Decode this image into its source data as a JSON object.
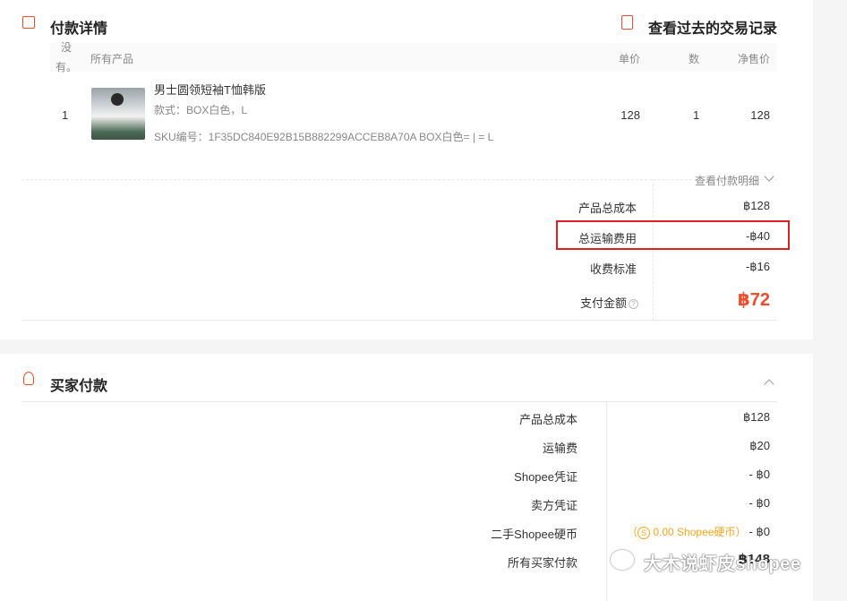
{
  "payment_details": {
    "title": "付款详情",
    "history_link": "查看过去的交易记录",
    "table": {
      "col_index": "没有。",
      "col_product": "所有产品",
      "col_unit_price": "单价",
      "col_qty": "数",
      "col_net_price": "净售价"
    },
    "item": {
      "index": "1",
      "name": "男士圆领短袖T恤韩版",
      "variation": "款式：BOX白色，L",
      "sku": "SKU编号：1F35DC840E92B15B882299ACCEB8A70A BOX白色= | = L",
      "unit_price": "128",
      "qty": "1",
      "net_price": "128"
    },
    "view_breakdown": "查看付款明细",
    "summary": [
      {
        "label": "产品总成本",
        "value": "฿128"
      },
      {
        "label": "总运输费用",
        "value": "-฿40"
      },
      {
        "label": "收费标准",
        "value": "-฿16"
      }
    ],
    "total_label": "支付金额",
    "total_value": "฿72"
  },
  "buyer_payment": {
    "title": "买家付款",
    "rows": [
      {
        "label": "产品总成本",
        "value": "฿128"
      },
      {
        "label": "运输费",
        "value": "฿20"
      },
      {
        "label": "Shopee凭证",
        "value": "- ฿0"
      },
      {
        "label": "卖方凭证",
        "value": "- ฿0"
      },
      {
        "label": "二手Shopee硬币",
        "value": "- ฿0",
        "note_prefix": "（",
        "note_coin": "S",
        "note_text": "0.00 Shopee硬币",
        "note_suffix": "）"
      },
      {
        "label": "所有买家付款",
        "value": "฿148"
      }
    ]
  },
  "watermark": "大木说虾皮shopee",
  "colors": {
    "accent": "#ee4d2d",
    "highlight_box": "#e02020",
    "coin": "#f5a623"
  }
}
